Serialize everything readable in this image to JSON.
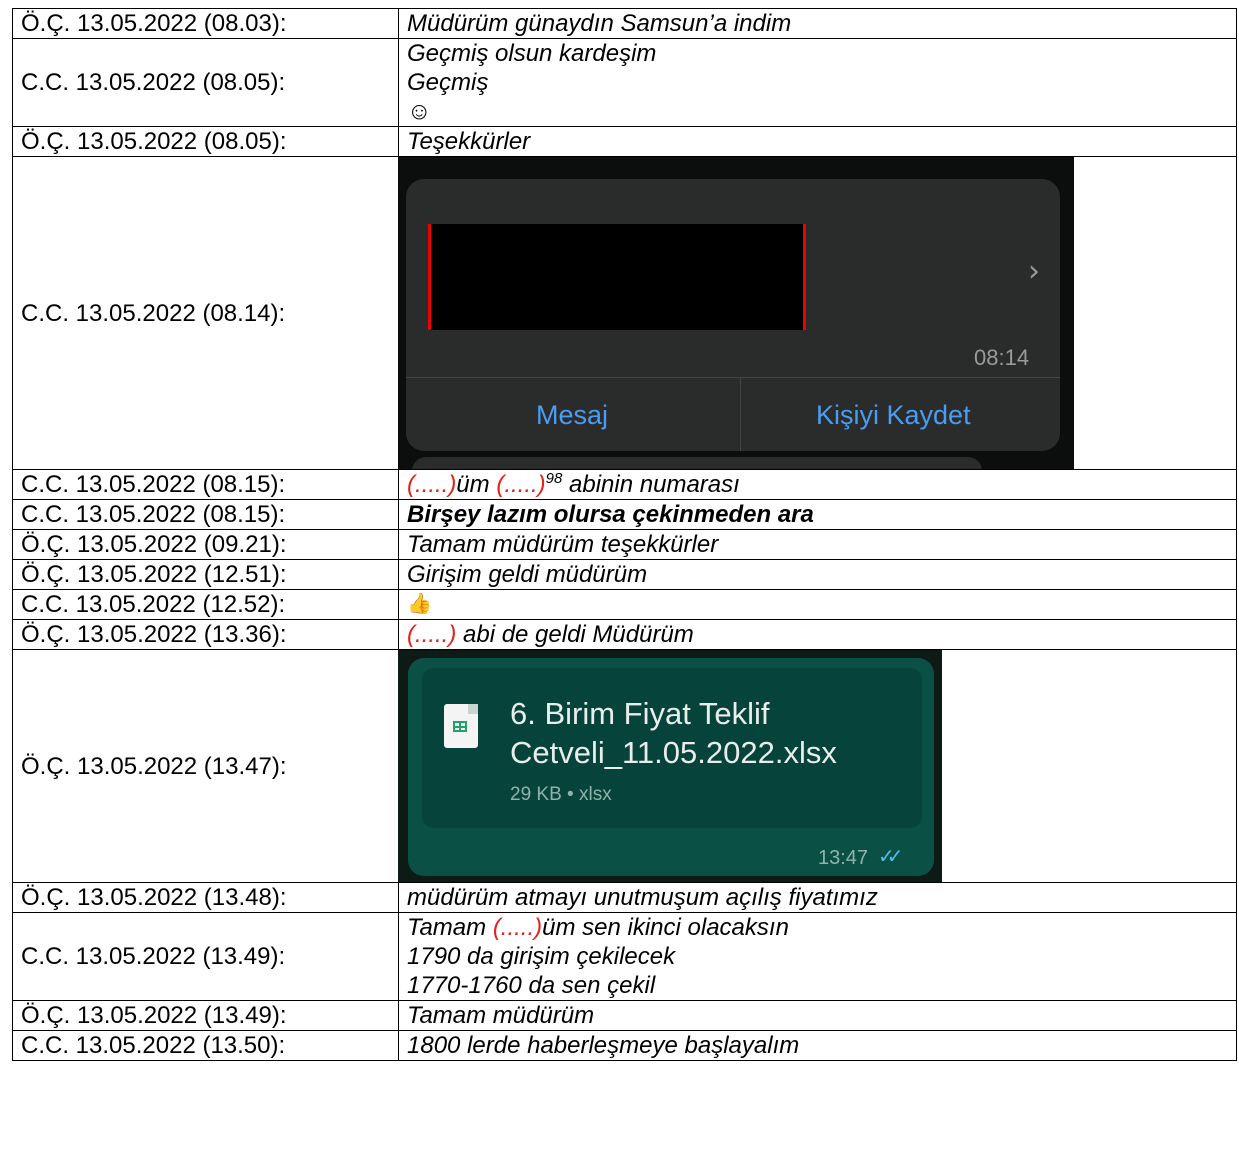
{
  "rows": [
    {
      "who": "Ö.Ç. 13.05.2022 (08.03):",
      "msg": "Müdürüm günaydın Samsun’a indim"
    },
    {
      "who": "C.C. 13.05.2022 (08.05):",
      "lines": [
        "Geçmiş olsun kardeşim",
        "Geçmiş",
        "☺"
      ]
    },
    {
      "who": "Ö.Ç. 13.05.2022 (08.05):",
      "msg": "Teşekkürler"
    },
    {
      "who": "C.C. 13.05.2022 (08.14):",
      "card": {
        "time": "08:14",
        "chevron": "›",
        "btn_message": "Mesaj",
        "btn_save": "Kişiyi Kaydet"
      }
    },
    {
      "who": "C.C. 13.05.2022 (08.15):",
      "red1": "(.....)",
      "mid": "üm ",
      "red2": "(.....)",
      "sup": "98",
      "tail": " abinin numarası"
    },
    {
      "who": "C.C. 13.05.2022 (08.15):",
      "msg": "Birşey lazım olursa çekinmeden ara"
    },
    {
      "who": "Ö.Ç. 13.05.2022 (09.21):",
      "msg": "Tamam müdürüm teşekkürler"
    },
    {
      "who": "Ö.Ç. 13.05.2022 (12.51):",
      "msg": "Girişim geldi müdürüm"
    },
    {
      "who": "C.C. 13.05.2022 (12.52):",
      "msg": "👍"
    },
    {
      "who": "Ö.Ç. 13.05.2022 (13.36):",
      "red": "(.....)",
      "tail": " abi de geldi Müdürüm"
    },
    {
      "who": "Ö.Ç. 13.05.2022 (13.47):",
      "file": {
        "name1": "6. Birim Fiyat Teklif",
        "name2": "Cetveli_11.05.2022.xlsx",
        "meta": "29 KB • xlsx",
        "time": "13:47",
        "ticks": "✓✓"
      }
    },
    {
      "who": "Ö.Ç. 13.05.2022 (13.48):",
      "msg": "müdürüm atmayı unutmuşum açılış fiyatımız"
    },
    {
      "who": "C.C. 13.05.2022 (13.49):",
      "l1a": "Tamam ",
      "l1red": "(.....)",
      "l1b": "üm sen ikinci olacaksın",
      "l2": "1790 da girişim çekilecek",
      "l3": "1770-1760 da sen çekil"
    },
    {
      "who": "Ö.Ç. 13.05.2022 (13.49):",
      "msg": "Tamam müdürüm"
    },
    {
      "who": "C.C. 13.05.2022 (13.50):",
      "msg": "1800 lerde haberleşmeye başlayalım"
    }
  ]
}
